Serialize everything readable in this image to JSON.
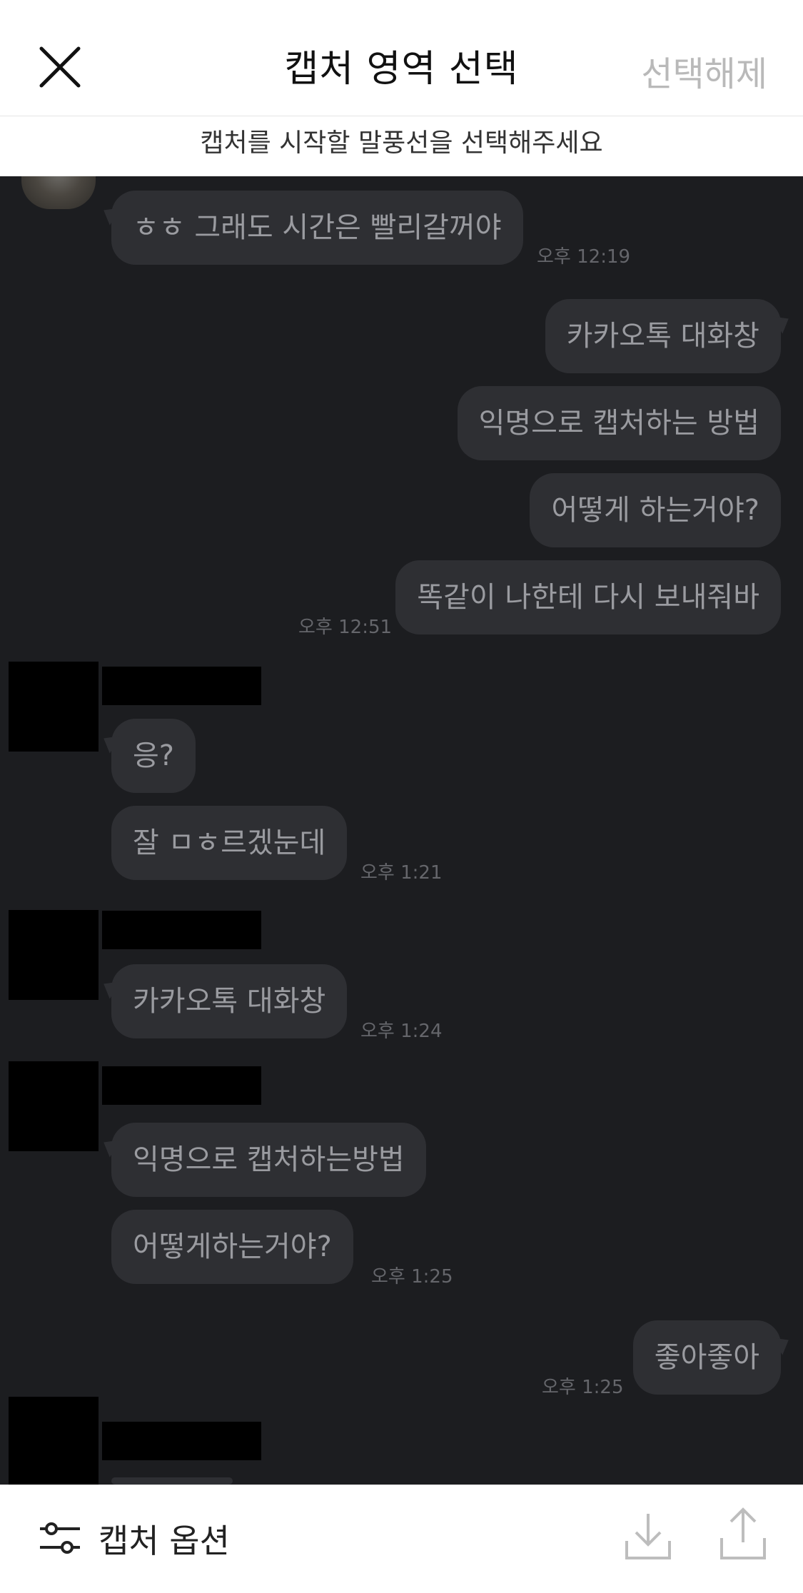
{
  "header": {
    "title": "캡처 영역 선택",
    "deselect_label": "선택해제",
    "close_icon": "close-icon"
  },
  "subheader": {
    "instruction": "캡처를 시작할 말풍선을 선택해주세요"
  },
  "messages": [
    {
      "side": "left",
      "text": "ㅎㅎ 그래도 시간은 빨리갈꺼야",
      "time": "오후 12:19"
    },
    {
      "side": "right",
      "text": "카카오톡 대화창"
    },
    {
      "side": "right",
      "text": "익명으로 캡처하는 방법"
    },
    {
      "side": "right",
      "text": "어떻게 하는거야?"
    },
    {
      "side": "right",
      "text": "똑같이 나한테 다시 보내줘바",
      "time": "오후 12:51"
    },
    {
      "side": "left",
      "text": "응?"
    },
    {
      "side": "left",
      "text": "잘 ㅁㅎ르겠눈데",
      "time": "오후 1:21"
    },
    {
      "side": "left",
      "text": "카카오톡 대화창",
      "time": "오후 1:24"
    },
    {
      "side": "left",
      "text": "익명으로 캡처하는방법"
    },
    {
      "side": "left",
      "text": "어떻게하는거야?",
      "time": "오후 1:25"
    },
    {
      "side": "right",
      "text": "좋아좋아",
      "time": "오후 1:25"
    }
  ],
  "toolbar": {
    "options_label": "캡처 옵션",
    "options_icon": "sliders-icon",
    "download_icon": "download-icon",
    "share_icon": "share-icon"
  }
}
